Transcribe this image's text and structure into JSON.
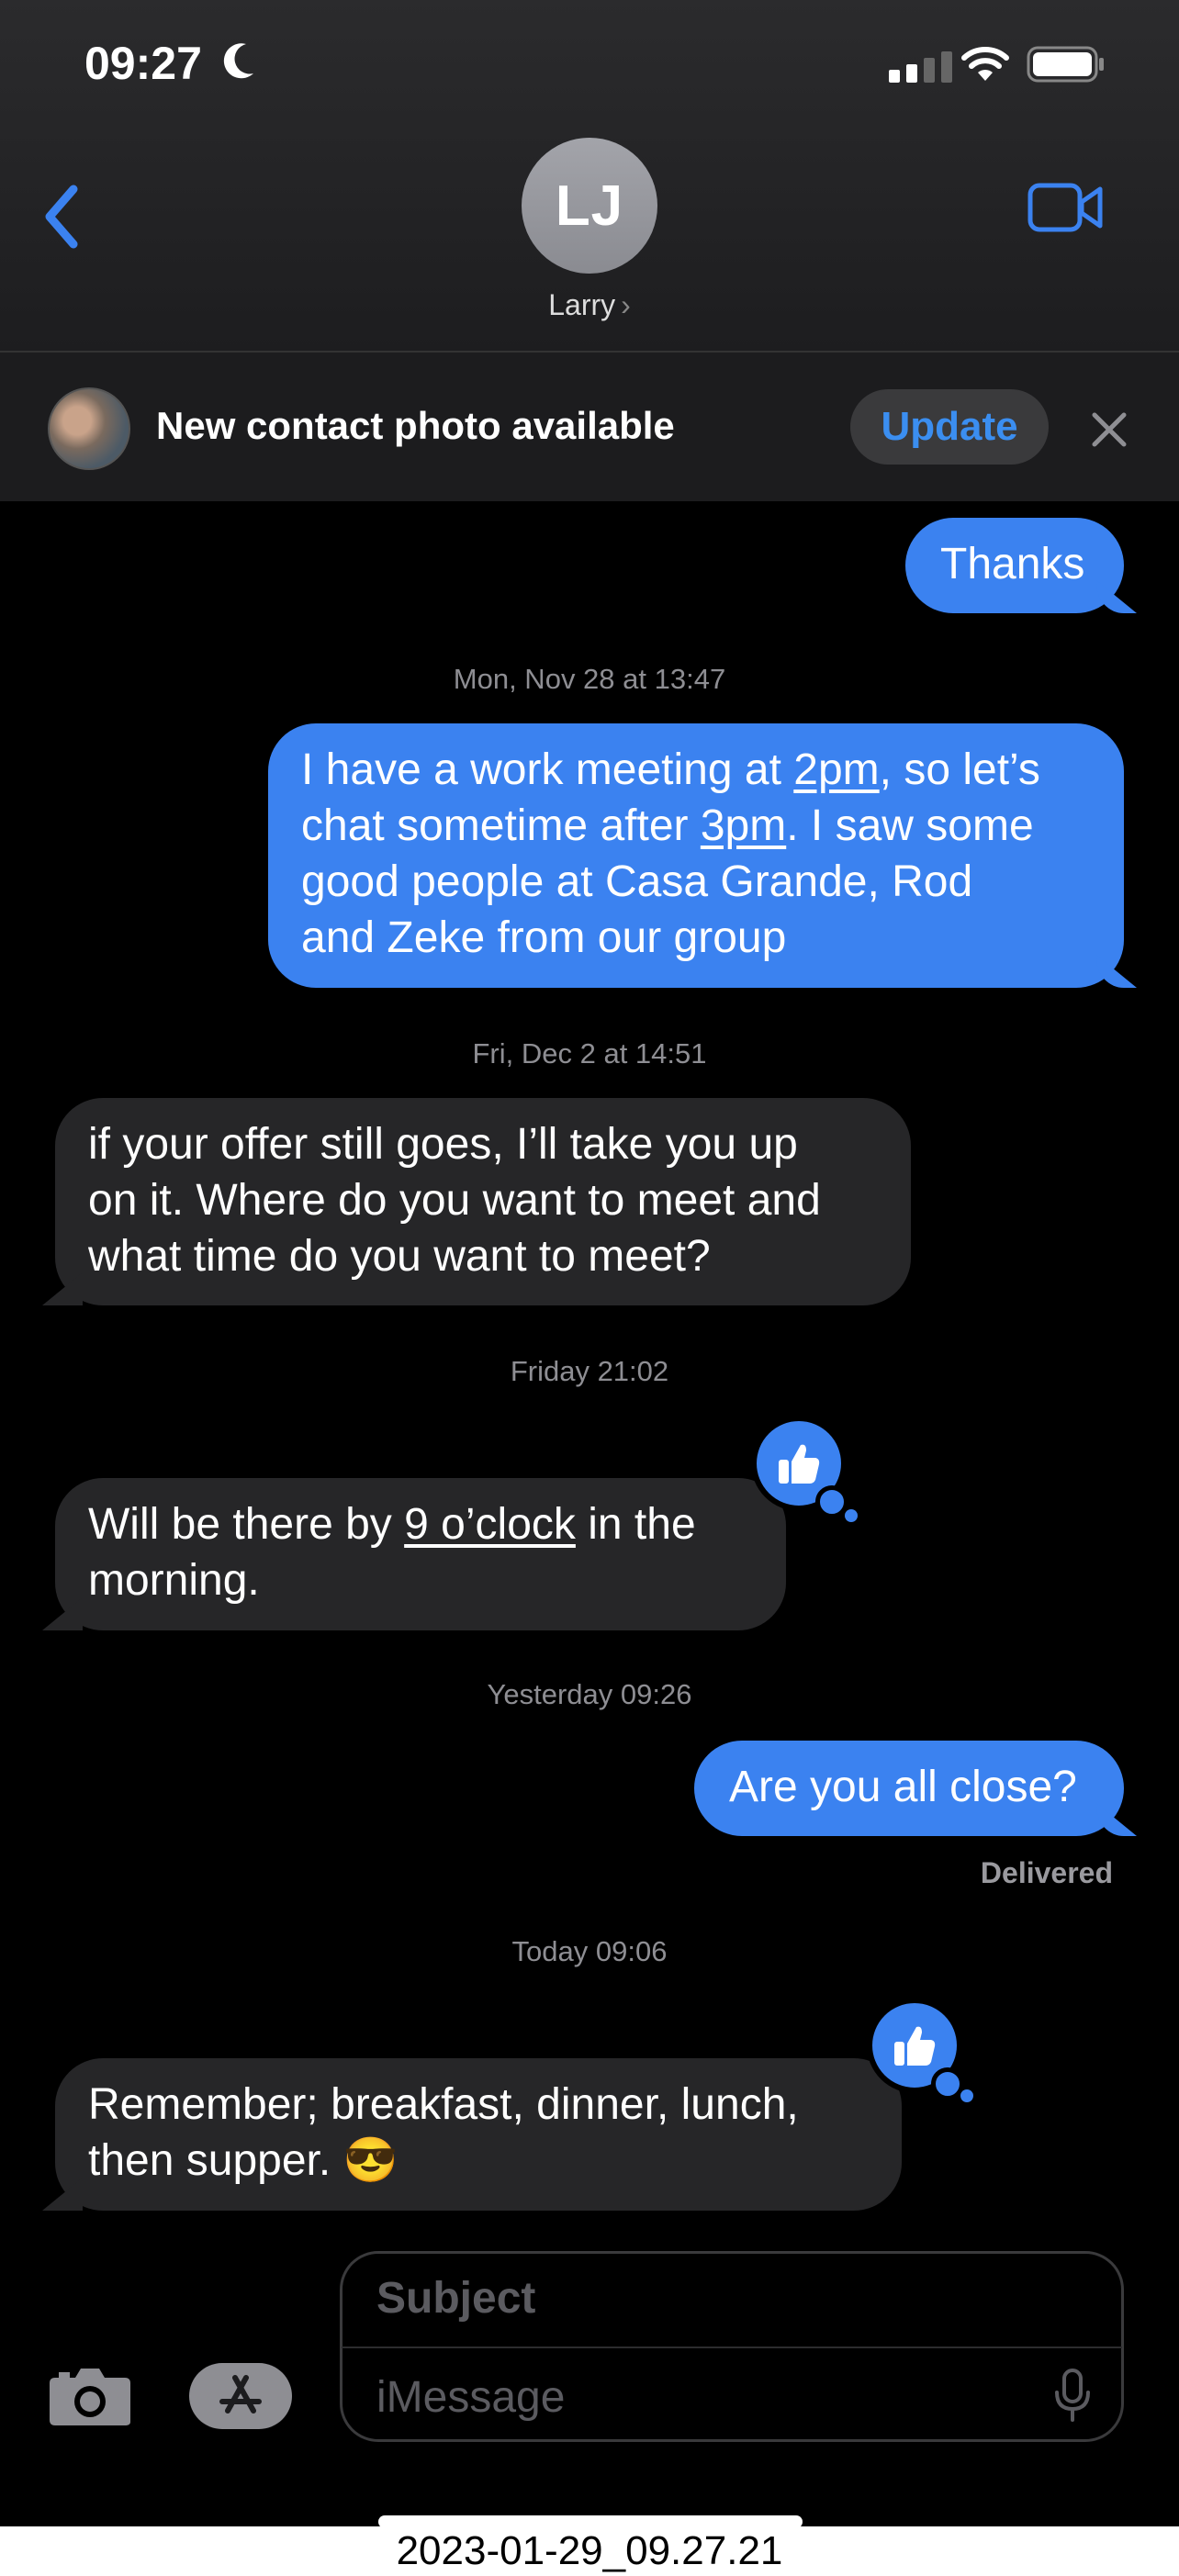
{
  "status_bar": {
    "time": "09:27"
  },
  "header": {
    "avatar_initials": "LJ",
    "contact_name": "Larry",
    "chevron": "›"
  },
  "banner": {
    "text": "New contact photo available",
    "update_label": "Update"
  },
  "messages": {
    "m1": {
      "text": "Thanks"
    },
    "ts1": "Mon, Nov 28 at 13:47",
    "m2": {
      "l1a": "I have a work meeting at ",
      "l1b": "2pm",
      "l1c": ", so let’s",
      "l2a": "chat sometime after ",
      "l2b": "3pm",
      "l2c": ". I saw some",
      "l3": "good people at Casa Grande, Rod",
      "l4": "and  Zeke from our group"
    },
    "ts2": "Fri, Dec 2 at 14:51",
    "m3": {
      "l1": "if your offer still goes, I’ll take you up",
      "l2": "on it. Where do you want to meet and",
      "l3": "what time do you want to meet?"
    },
    "ts3": "Friday 21:02",
    "m4": {
      "l1a": "Will be there by ",
      "l1b": "9 o’clock",
      "l1c": " in the",
      "l2": "morning."
    },
    "ts4": "Yesterday 09:26",
    "m5": {
      "text": "Are you all close?"
    },
    "delivered": "Delivered",
    "ts5": "Today 09:06",
    "m6": {
      "l1": "Remember;  breakfast, dinner, lunch,",
      "l2": "then supper.   😎"
    }
  },
  "compose": {
    "subject_placeholder": "Subject",
    "message_placeholder": "iMessage"
  },
  "caption": "2023-01-29_09.27.21",
  "colors": {
    "accent": "#3b82f0",
    "incoming": "#262628",
    "background": "#000000"
  },
  "icons": [
    "moon-icon",
    "cellular-signal-icon",
    "wifi-icon",
    "battery-icon",
    "back-chevron-icon",
    "facetime-video-icon",
    "close-icon",
    "thumbs-up-icon",
    "camera-icon",
    "app-store-icon",
    "microphone-icon"
  ]
}
